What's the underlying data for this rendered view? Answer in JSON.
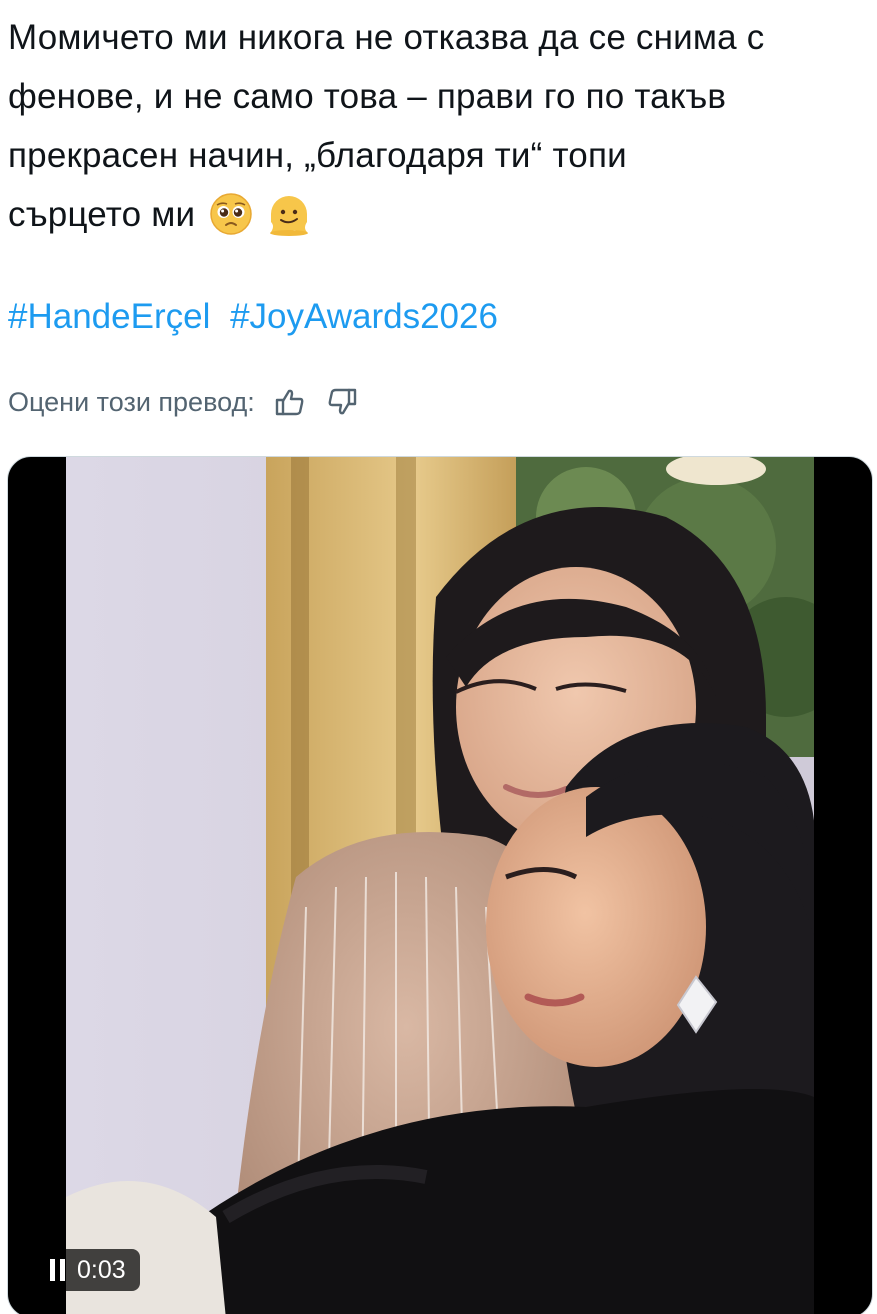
{
  "post": {
    "lines": [
      "Момичето ми никога не отказва да се снима с",
      "фенове, и не само това – прави го по такъв",
      "прекрасен начин, „благодаря ти“ топи",
      "сърцето ми"
    ],
    "emojis": [
      "pleading-face-emoji",
      "melting-face-emoji"
    ]
  },
  "hashtags": [
    "#HandeErçel",
    "#JoyAwards2026"
  ],
  "translation_rating": {
    "label": "Оцени този превод:",
    "icons": [
      "thumbs-up-icon",
      "thumbs-down-icon"
    ]
  },
  "video": {
    "time": "0:03",
    "state_icon": "pause-icon"
  },
  "colors": {
    "text": "#0f1419",
    "link": "#1d9bf0",
    "secondary": "#536471"
  }
}
